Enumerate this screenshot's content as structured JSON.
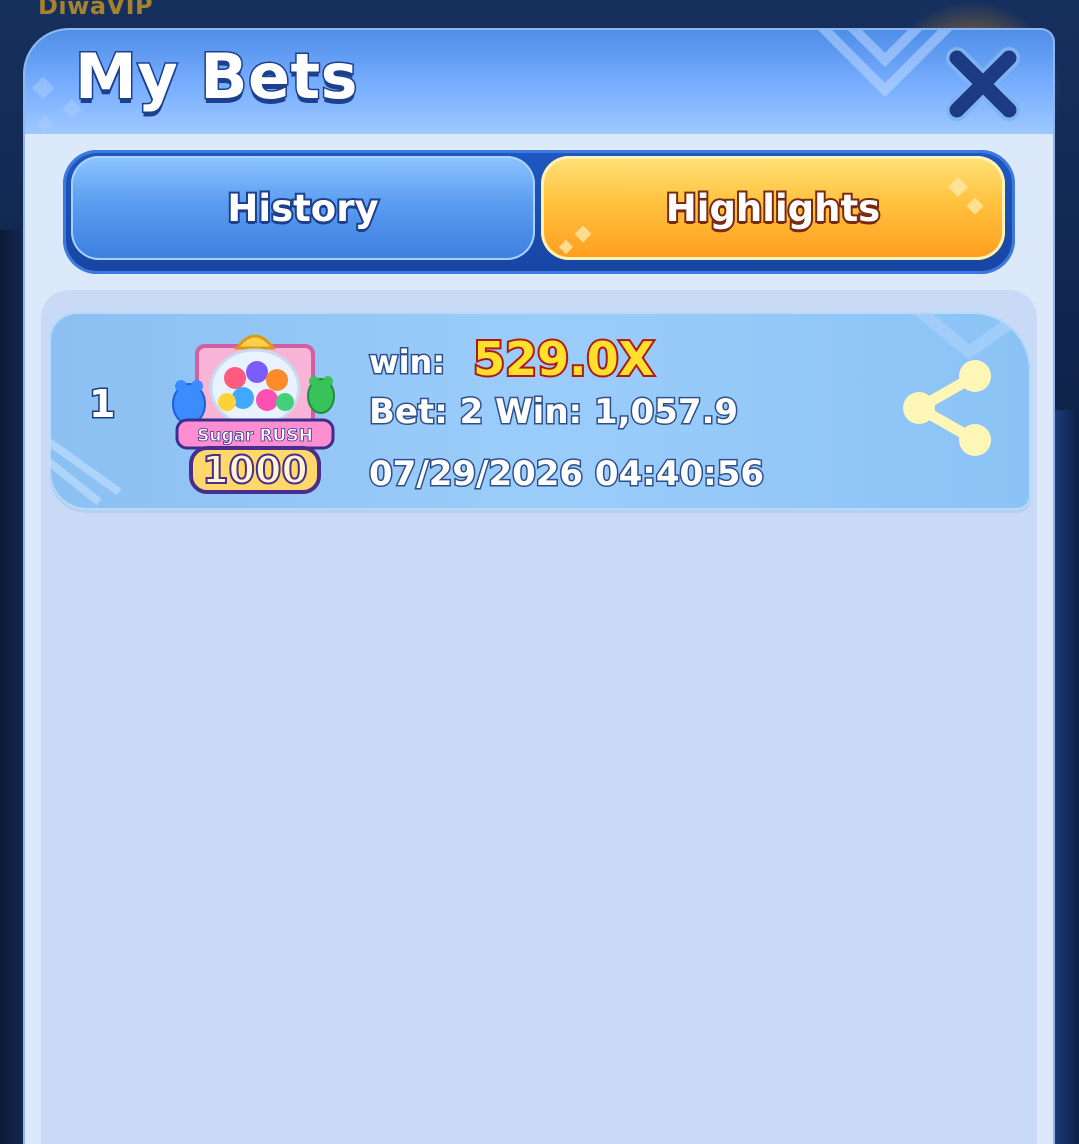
{
  "background": {
    "brand_text": "DiwaVIP"
  },
  "modal": {
    "title": "My Bets",
    "close_icon": "close-icon"
  },
  "tabs": [
    {
      "label": "History",
      "selected": false
    },
    {
      "label": "Highlights",
      "selected": true
    }
  ],
  "bets": [
    {
      "rank": "1",
      "game_name": "Sugar Rush 1000",
      "game_icon": "sugar-rush-1000-icon",
      "win_label": "win:",
      "multiplier": "529.0X",
      "bet_win_text": "Bet: 2 Win: 1,057.9",
      "timestamp": "07/29/2026 04:40:56",
      "share_icon": "share-icon"
    }
  ],
  "colors": {
    "header_blue": "#4f8ee8",
    "active_tab_orange": "#ffc23e",
    "inactive_tab_blue": "#5b9df0",
    "multiplier_yellow": "#ffe02a",
    "multiplier_outline_red": "#b0181a",
    "panel_bg": "#c9daf6",
    "row_bg": "#9bcdfa"
  }
}
